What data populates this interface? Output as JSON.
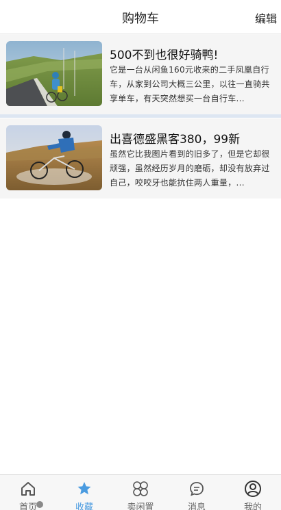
{
  "header": {
    "title": "购物车",
    "edit_label": "编辑"
  },
  "items": [
    {
      "title": "500不到也很好骑鸭!",
      "description": "它是一台从闲鱼160元收来的二手凤凰自行车，从家到公司大概三公里，以往一直骑共享单车，有天突然想买一台自行车...",
      "image": "cyclist-road-photo"
    },
    {
      "title": "出喜德盛黑客380，99新",
      "description": "虽然它比我图片看到的旧多了，但是它却很顽强，虽然经历岁月的磨砺，却没有放弃过自己，咬咬牙也能抗住两人重量，...",
      "image": "mountain-bike-splash-photo"
    }
  ],
  "tabbar": {
    "tabs": [
      {
        "label": "首页",
        "icon": "home-icon"
      },
      {
        "label": "收藏",
        "icon": "star-icon",
        "active": true
      },
      {
        "label": "卖闲置",
        "icon": "grid-icon"
      },
      {
        "label": "消息",
        "icon": "message-icon"
      },
      {
        "label": "我的",
        "icon": "user-icon"
      }
    ]
  },
  "colors": {
    "accent": "#4a9be0",
    "separator": "#dde6f2",
    "item_bg": "#f5f5f5"
  }
}
